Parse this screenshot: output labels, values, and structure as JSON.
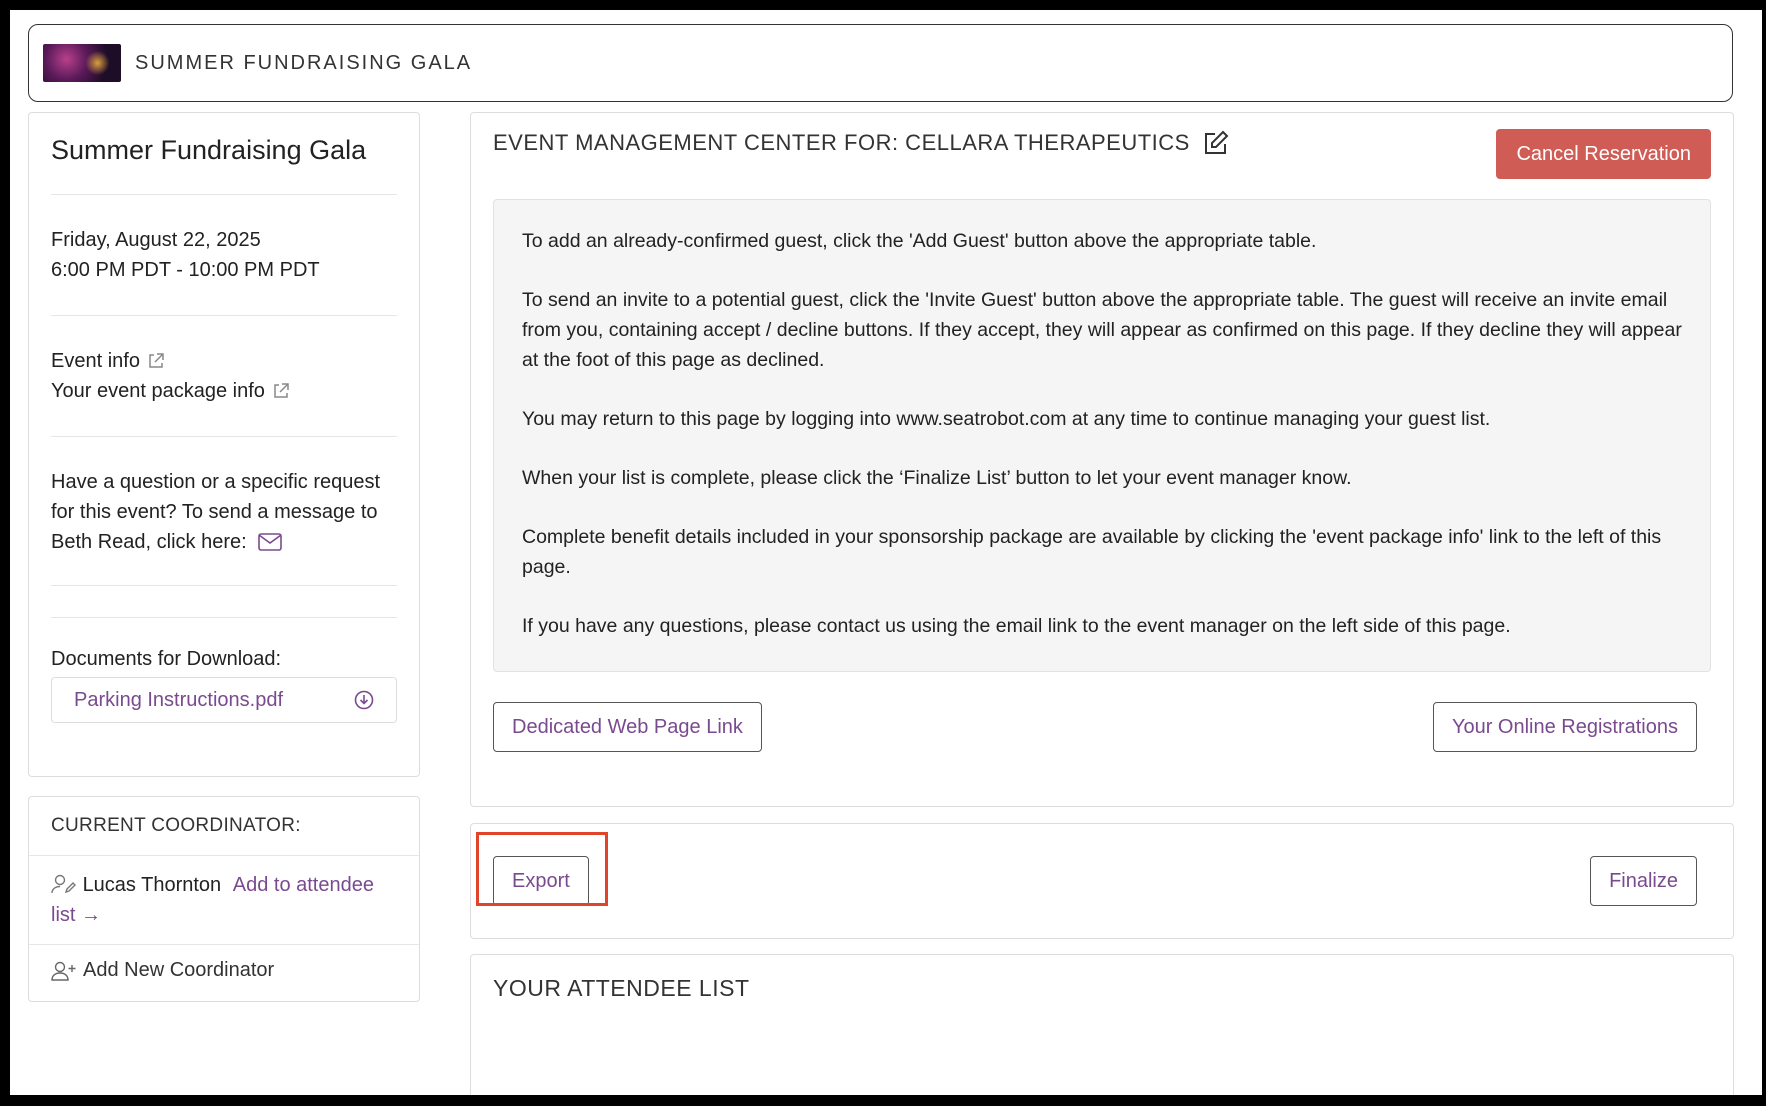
{
  "header": {
    "logo_icon": "event-photo-logo",
    "title": "SUMMER FUNDRAISING GALA"
  },
  "event": {
    "title": "Summer Fundraising Gala",
    "date": "Friday, August 22, 2025",
    "time": "6:00 PM PDT - 10:00 PM PDT",
    "event_info_link": "Event info",
    "package_info_link": "Your event package info",
    "question_text": "Have a question or a specific request for this event? To send a message to Beth Read, click here:",
    "documents_label": "Documents for Download:",
    "documents": [
      {
        "name": "Parking Instructions.pdf",
        "icon": "download-icon"
      }
    ]
  },
  "coordinator": {
    "heading": "CURRENT COORDINATOR:",
    "name": "Lucas Thornton",
    "add_link": "Add to attendee list →",
    "add_new": "Add New Coordinator"
  },
  "main": {
    "title": "EVENT MANAGEMENT CENTER FOR: CELLARA THERAPEUTICS",
    "edit_icon": "edit-icon",
    "cancel_button": "Cancel Reservation",
    "instructions": [
      "To add an already-confirmed guest, click the 'Add Guest' button above the appropriate table.",
      "To send an invite to a potential guest, click the 'Invite Guest' button above the appropriate table. The guest will receive an invite email from you, containing accept / decline buttons. If they accept, they will appear as confirmed on this page. If they decline they will appear at the foot of this page as declined.",
      "You may return to this page by logging into www.seatrobot.com at any time to continue managing your guest list.",
      "When your list is complete, please click the ‘Finalize List’ button to let your event manager know.",
      "Complete benefit details included in your sponsorship package are available by clicking the 'event package info' link to the left of this page.",
      "If you have any questions, please contact us using the email link to the event manager on the left side of this page."
    ],
    "dedicated_link_button": "Dedicated Web Page Link",
    "online_registrations_button": "Your Online Registrations"
  },
  "actions": {
    "export_button": "Export",
    "finalize_button": "Finalize"
  },
  "attendees": {
    "title": "YOUR ATTENDEE LIST"
  },
  "colors": {
    "accent_purple": "#7a4a8f",
    "cancel_red": "#d05d55",
    "highlight_red": "#e0452b"
  }
}
